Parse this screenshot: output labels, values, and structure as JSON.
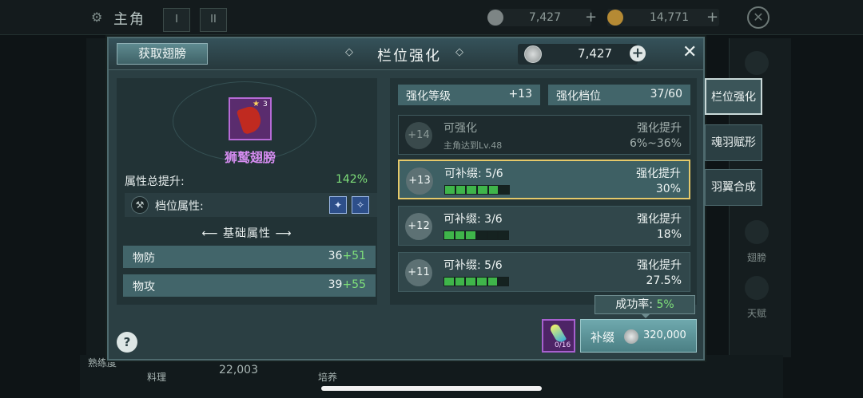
{
  "background": {
    "title": "主角",
    "tabs": [
      "I",
      "II"
    ],
    "silver": "7,427",
    "gold": "14,771",
    "right_menu": [
      "翅膀",
      "天赋"
    ],
    "bottom": {
      "label1": "料理",
      "value": "22,003",
      "label2": "培养",
      "label3": "熟练度"
    }
  },
  "modal": {
    "get_wings_label": "获取翅膀",
    "title": "栏位强化",
    "currency": "7,427",
    "plus": "+",
    "close": "✕",
    "help": "?",
    "item": {
      "name": "狮鹫翅膀",
      "stars": "3",
      "total_label": "属性总提升:",
      "total_value": "142%",
      "slot_label": "档位属性:",
      "base_title": "基础属性",
      "stats": [
        {
          "label": "物防",
          "base": "36",
          "add": "+51"
        },
        {
          "label": "物攻",
          "base": "39",
          "add": "+55"
        }
      ]
    },
    "enhance": {
      "level_label": "强化等级",
      "level_value": "+13",
      "tier_label": "强化档位",
      "tier_value": "37/60",
      "levels": [
        {
          "badge": "+14",
          "title": "可强化",
          "sub": "主角达到Lv.48",
          "bonus_label": "强化提升",
          "bonus": "6%~36%",
          "locked": true
        },
        {
          "badge": "+13",
          "title": "可补缀: 5/6",
          "bonus_label": "强化提升",
          "bonus": "30%",
          "filled": 5,
          "total": 6,
          "selected": true
        },
        {
          "badge": "+12",
          "title": "可补缀: 3/6",
          "bonus_label": "强化提升",
          "bonus": "18%",
          "filled": 3,
          "total": 6
        },
        {
          "badge": "+11",
          "title": "可补缀: 5/6",
          "bonus_label": "强化提升",
          "bonus": "27.5%",
          "filled": 5,
          "total": 6
        }
      ],
      "success_label": "成功率:",
      "success_value": "5%"
    },
    "material_count": "0/16",
    "craft_label": "补缀",
    "craft_cost": "320,000"
  },
  "side_tabs": [
    "栏位强化",
    "魂羽赋形",
    "羽翼合成"
  ],
  "colors": {
    "accent_green": "#7fe07a",
    "item_purple": "#d58cf0",
    "select_gold": "#e5c96a"
  }
}
